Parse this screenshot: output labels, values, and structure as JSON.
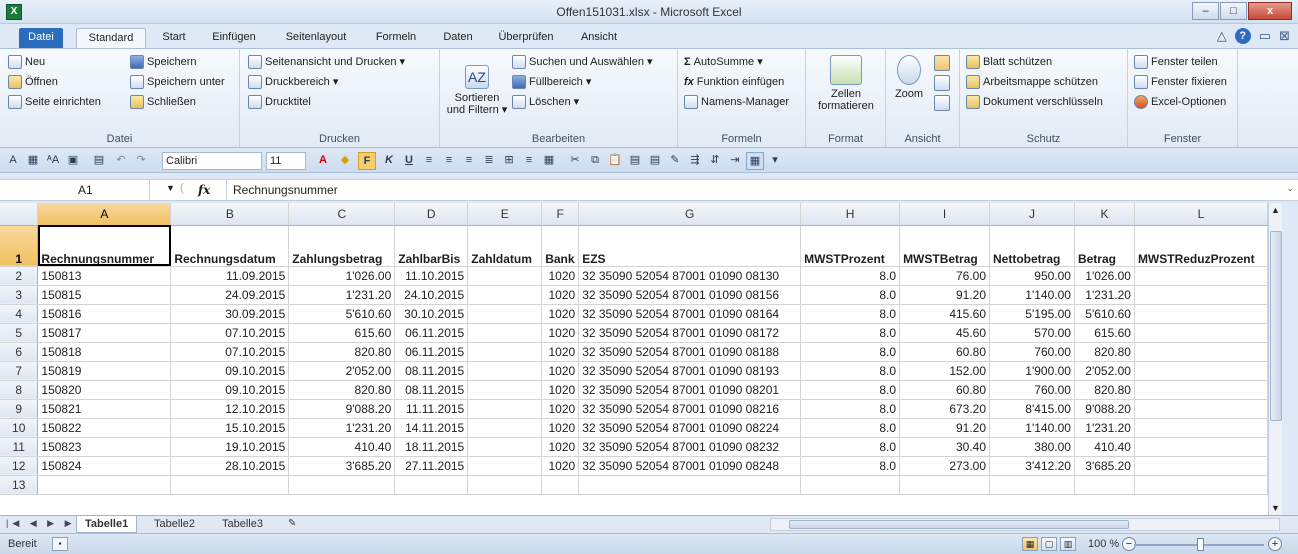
{
  "window": {
    "title": "Offen151031.xlsx - Microsoft Excel",
    "app_icon": "X",
    "min": "–",
    "max": "□",
    "close": "x"
  },
  "tabs": [
    "Datei",
    "Standard",
    "Start",
    "Einfügen",
    "Seitenlayout",
    "Formeln",
    "Daten",
    "Überprüfen",
    "Ansicht"
  ],
  "ribbon": {
    "datei": {
      "label": "Datei",
      "neu": "Neu",
      "oeffnen": "Öffnen",
      "seite": "Seite einrichten",
      "speichern": "Speichern",
      "speichern_unter": "Speichern unter",
      "schliessen": "Schließen"
    },
    "drucken": {
      "label": "Drucken",
      "seitenansicht": "Seitenansicht und Drucken ▾",
      "druckbereich": "Druckbereich ▾",
      "drucktitel": "Drucktitel"
    },
    "bearbeiten": {
      "label": "Bearbeiten",
      "sortieren": "Sortieren\nund Filtern ▾",
      "suchen": "Suchen und Auswählen ▾",
      "fuellbereich": "Füllbereich ▾",
      "loeschen": "Löschen ▾"
    },
    "formeln": {
      "label": "Formeln",
      "autosumme": "AutoSumme ▾",
      "funktion": "Funktion einfügen",
      "namens": "Namens-Manager"
    },
    "format": {
      "label": "Format",
      "zellen": "Zellen\nformatieren"
    },
    "ansicht": {
      "label": "Ansicht",
      "zoom": "Zoom"
    },
    "schutz": {
      "label": "Schutz",
      "blatt": "Blatt schützen",
      "arbeitsmappe": "Arbeitsmappe schützen",
      "dokument": "Dokument verschlüsseln"
    },
    "fenster": {
      "label": "Fenster",
      "teilen": "Fenster teilen",
      "fixieren": "Fenster fixieren",
      "optionen": "Excel-Optionen"
    }
  },
  "qat": {
    "font": "Calibri",
    "size": "11"
  },
  "formula_bar": {
    "cell": "A1",
    "fx": "fx",
    "content": "Rechnungsnummer"
  },
  "columns": [
    "A",
    "B",
    "C",
    "D",
    "E",
    "F",
    "G",
    "H",
    "I",
    "J",
    "K",
    "L"
  ],
  "headers": [
    "Rechnungsnummer",
    "Rechnungsdatum",
    "Zahlungsbetrag",
    "ZahlbarBis",
    "Zahldatum",
    "Bank",
    "EZS",
    "MWSTProzent",
    "MWSTBetrag",
    "Nettobetrag",
    "Betrag",
    "MWSTReduzProzent"
  ],
  "rows": [
    [
      "150813",
      "11.09.2015",
      "1'026.00",
      "11.10.2015",
      "",
      "1020",
      "32 35090 52054 87001 01090 08130",
      "8.0",
      "76.00",
      "950.00",
      "1'026.00",
      ""
    ],
    [
      "150815",
      "24.09.2015",
      "1'231.20",
      "24.10.2015",
      "",
      "1020",
      "32 35090 52054 87001 01090 08156",
      "8.0",
      "91.20",
      "1'140.00",
      "1'231.20",
      ""
    ],
    [
      "150816",
      "30.09.2015",
      "5'610.60",
      "30.10.2015",
      "",
      "1020",
      "32 35090 52054 87001 01090 08164",
      "8.0",
      "415.60",
      "5'195.00",
      "5'610.60",
      ""
    ],
    [
      "150817",
      "07.10.2015",
      "615.60",
      "06.11.2015",
      "",
      "1020",
      "32 35090 52054 87001 01090 08172",
      "8.0",
      "45.60",
      "570.00",
      "615.60",
      ""
    ],
    [
      "150818",
      "07.10.2015",
      "820.80",
      "06.11.2015",
      "",
      "1020",
      "32 35090 52054 87001 01090 08188",
      "8.0",
      "60.80",
      "760.00",
      "820.80",
      ""
    ],
    [
      "150819",
      "09.10.2015",
      "2'052.00",
      "08.11.2015",
      "",
      "1020",
      "32 35090 52054 87001 01090 08193",
      "8.0",
      "152.00",
      "1'900.00",
      "2'052.00",
      ""
    ],
    [
      "150820",
      "09.10.2015",
      "820.80",
      "08.11.2015",
      "",
      "1020",
      "32 35090 52054 87001 01090 08201",
      "8.0",
      "60.80",
      "760.00",
      "820.80",
      ""
    ],
    [
      "150821",
      "12.10.2015",
      "9'088.20",
      "11.11.2015",
      "",
      "1020",
      "32 35090 52054 87001 01090 08216",
      "8.0",
      "673.20",
      "8'415.00",
      "9'088.20",
      ""
    ],
    [
      "150822",
      "15.10.2015",
      "1'231.20",
      "14.11.2015",
      "",
      "1020",
      "32 35090 52054 87001 01090 08224",
      "8.0",
      "91.20",
      "1'140.00",
      "1'231.20",
      ""
    ],
    [
      "150823",
      "19.10.2015",
      "410.40",
      "18.11.2015",
      "",
      "1020",
      "32 35090 52054 87001 01090 08232",
      "8.0",
      "30.40",
      "380.00",
      "410.40",
      ""
    ],
    [
      "150824",
      "28.10.2015",
      "3'685.20",
      "27.11.2015",
      "",
      "1020",
      "32 35090 52054 87001 01090 08248",
      "8.0",
      "273.00",
      "3'412.20",
      "3'685.20",
      ""
    ]
  ],
  "sheets": [
    "Tabelle1",
    "Tabelle2",
    "Tabelle3"
  ],
  "status": {
    "text": "Bereit",
    "zoom": "100 %"
  }
}
